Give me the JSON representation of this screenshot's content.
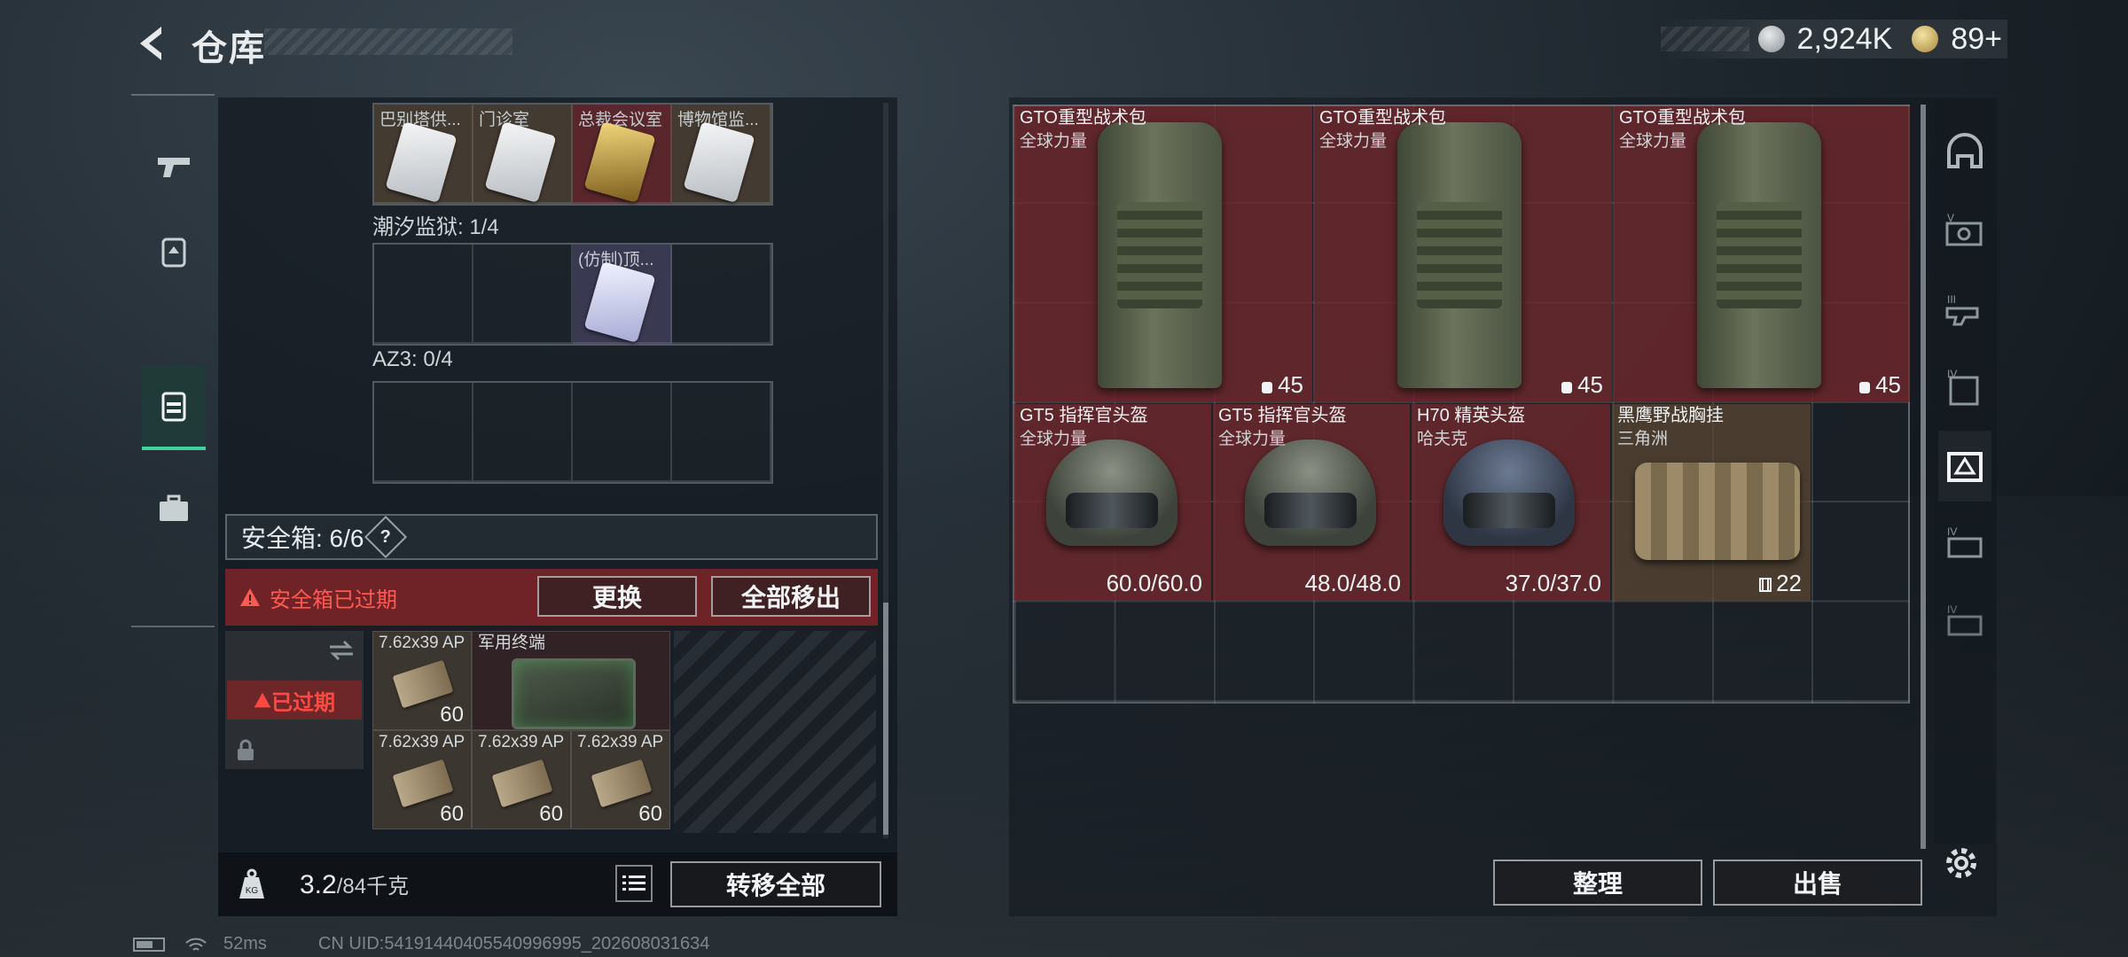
{
  "header": {
    "title": "仓库",
    "currency": [
      {
        "icon": "silver-coin-icon",
        "value": "2,924K"
      },
      {
        "icon": "gold-coin-icon",
        "value": "89+"
      }
    ]
  },
  "left_nav": [
    "pistol-icon",
    "backpack-icon",
    "vest-icon",
    "briefcase-icon"
  ],
  "keycards": {
    "top_row": [
      {
        "label": "巴别塔供...",
        "color": "red"
      },
      {
        "label": "门诊室",
        "color": "brown"
      },
      {
        "label": "总裁会议室",
        "color": "gold"
      },
      {
        "label": "博物馆监...",
        "color": "brown"
      }
    ],
    "section2": {
      "title": "潮汐监狱: 1/4",
      "card_label": "(仿制)顶..."
    },
    "section3": {
      "title": "AZ3: 0/4"
    }
  },
  "safe_box": {
    "label": "安全箱: 6/6",
    "help": "?",
    "warning": "安全箱已过期",
    "replace_btn": "更换",
    "remove_all_btn": "全部移出",
    "expired_label": "已过期"
  },
  "safe_items": [
    {
      "label": "7.62x39 AP",
      "qty": "60"
    },
    {
      "label": "军用终端",
      "qty": ""
    },
    {
      "label": "7.62x39 AP",
      "qty": "60"
    },
    {
      "label": "7.62x39 AP",
      "qty": "60"
    },
    {
      "label": "7.62x39 AP",
      "qty": "60"
    }
  ],
  "footer": {
    "weight": "3.2",
    "weight_max": "/84千克",
    "transfer_all": "转移全部",
    "sort_btn": "整理",
    "sell_btn": "出售"
  },
  "storage": [
    {
      "name": "GTO重型战术包",
      "sub": "全球力量",
      "value": "45"
    },
    {
      "name": "GTO重型战术包",
      "sub": "全球力量",
      "value": "45"
    },
    {
      "name": "GTO重型战术包",
      "sub": "全球力量",
      "value": "45"
    },
    {
      "name": "GT5 指挥官头盔",
      "sub": "全球力量",
      "value": "60.0/60.0"
    },
    {
      "name": "GT5 指挥官头盔",
      "sub": "全球力量",
      "value": "48.0/48.0"
    },
    {
      "name": "H70 精英头盔",
      "sub": "哈夫克",
      "value": "37.0/37.0"
    },
    {
      "name": "黑鹰野战胸挂",
      "sub": "三角洲",
      "value": "22"
    }
  ],
  "right_nav": [
    "helmet-tab-icon",
    "case-v-icon",
    "case-iii-icon",
    "case-iv-icon",
    "case-selected-icon",
    "case-iv-b-icon",
    "case-iv-c-icon"
  ],
  "status_bar": {
    "ping": "52ms",
    "uid": "CN UID:54191440405540996995_202608031634"
  }
}
